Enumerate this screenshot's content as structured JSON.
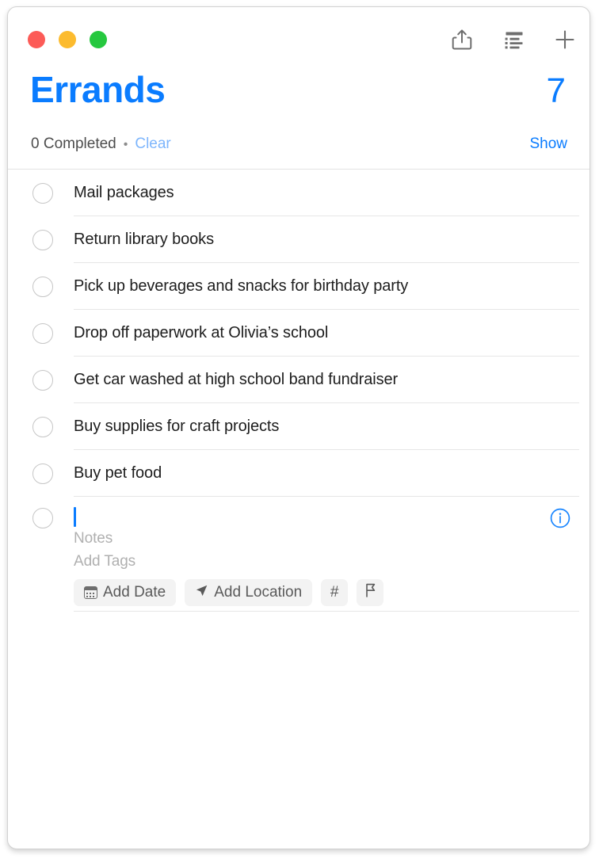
{
  "window": {
    "traffic_lights": [
      {
        "name": "close",
        "color": "#fc5b57"
      },
      {
        "name": "minimize",
        "color": "#fcbb2e"
      },
      {
        "name": "zoom",
        "color": "#26c83f"
      }
    ]
  },
  "toolbar": {
    "share_icon": "share-icon",
    "sort_icon": "list-sort-icon",
    "add_icon": "plus-icon"
  },
  "header": {
    "title": "Errands",
    "count": "7",
    "accent_color": "#0a7cff"
  },
  "completed_bar": {
    "completed_label": "0 Completed",
    "separator": "•",
    "clear_label": "Clear",
    "clear_color": "#7eb6fc",
    "show_label": "Show",
    "show_color": "#0a7cff"
  },
  "tasks": [
    {
      "title": "Mail packages",
      "completed": false
    },
    {
      "title": "Return library books",
      "completed": false
    },
    {
      "title": "Pick up beverages and snacks for birthday party",
      "completed": false
    },
    {
      "title": "Drop off paperwork at Olivia’s school",
      "completed": false
    },
    {
      "title": "Get car washed at high school band fundraiser",
      "completed": false
    },
    {
      "title": "Buy supplies for craft projects",
      "completed": false
    },
    {
      "title": "Buy pet food",
      "completed": false
    }
  ],
  "editing_row": {
    "title_value": "",
    "notes_placeholder": "Notes",
    "tags_placeholder": "Add Tags",
    "chips": [
      {
        "label": "Add Date",
        "icon": "calendar-icon"
      },
      {
        "label": "Add Location",
        "icon": "location-arrow-icon"
      },
      {
        "label": "#",
        "icon": "hash-icon"
      },
      {
        "label": "",
        "icon": "flag-icon"
      }
    ],
    "info_icon": "info-circle-icon",
    "caret_color": "#0a7cff"
  }
}
